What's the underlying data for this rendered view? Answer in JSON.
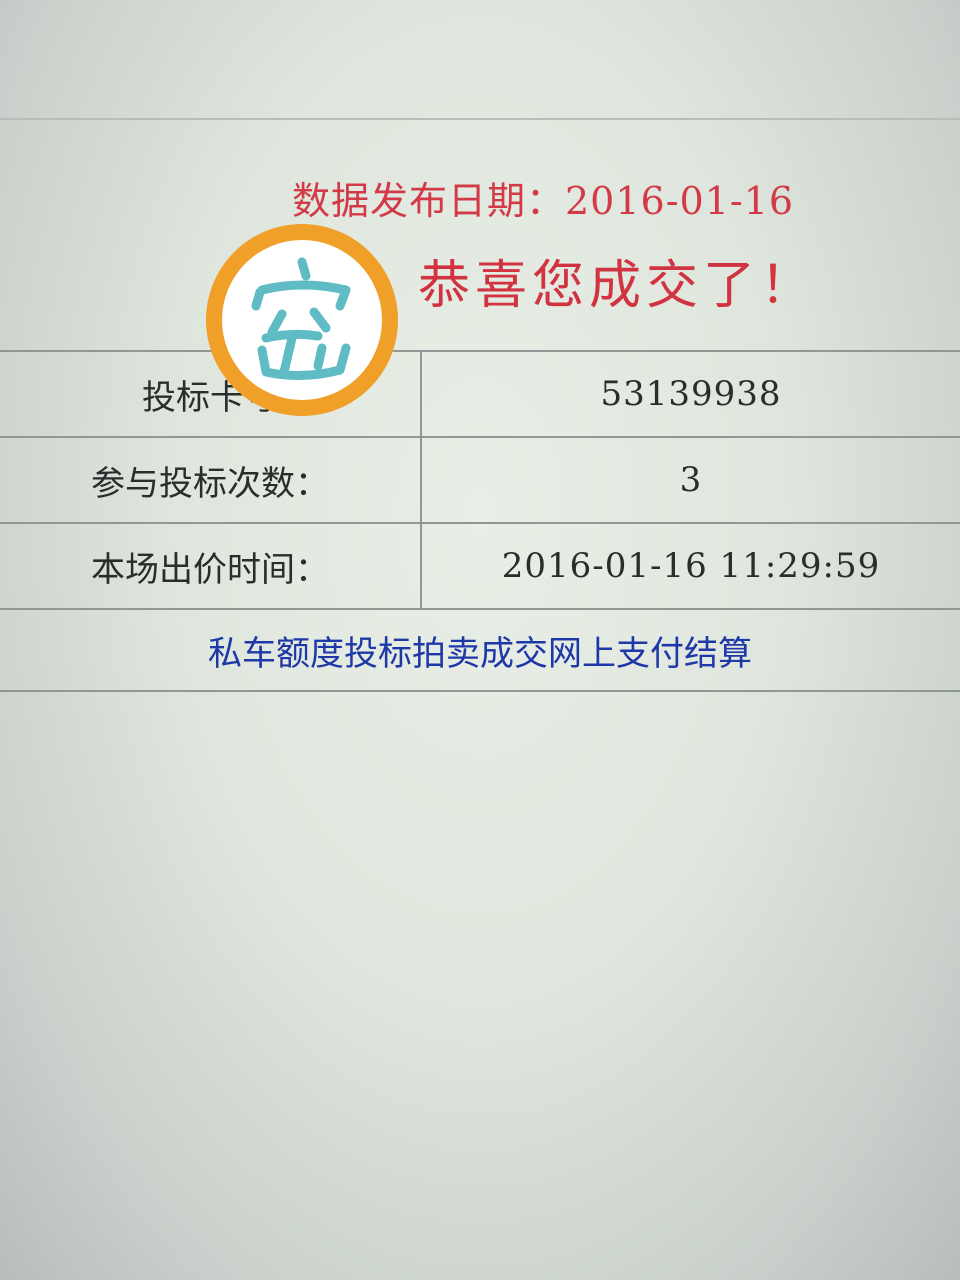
{
  "header": {
    "publish_date": "数据发布日期：2016-01-16",
    "congratulation": "恭喜您成交了！"
  },
  "result_table": {
    "rows": [
      {
        "label": "投标卡号",
        "value": "53139938"
      },
      {
        "label": "参与投标次数：",
        "value": "3"
      },
      {
        "label": "本场出价时间：",
        "value": "2016-01-16 11:29:59"
      }
    ]
  },
  "payment_link": "私车额度投标拍卖成交网上支付结算",
  "overlay": {
    "icon": "handwritten-character-sticker",
    "accent": "#f0a028",
    "stroke": "#5fbcc4"
  }
}
